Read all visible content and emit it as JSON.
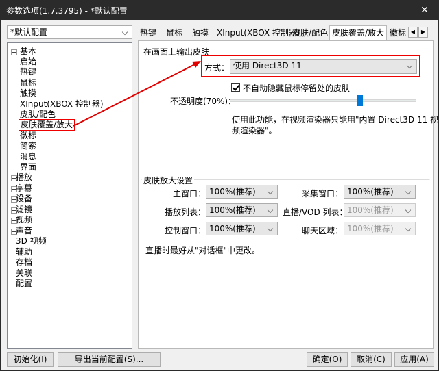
{
  "window": {
    "title": "参数选项(1.7.3795) - *默认配置",
    "close_glyph": "✕"
  },
  "profile": {
    "selected": "*默认配置"
  },
  "tree": {
    "root_basic": "基本",
    "basic_children": [
      "启始",
      "热键",
      "鼠标",
      "触摸",
      "XInput(XBOX 控制器)",
      "皮肤/配色",
      "皮肤覆盖/放大",
      "徽标",
      "简索",
      "消息",
      "界面"
    ],
    "others": [
      {
        "label": "播放",
        "expandable": true
      },
      {
        "label": "字幕",
        "expandable": true
      },
      {
        "label": "设备",
        "expandable": true
      },
      {
        "label": "滤镜",
        "expandable": true
      },
      {
        "label": "视频",
        "expandable": true
      },
      {
        "label": "声音",
        "expandable": true
      },
      {
        "label": "3D 视频",
        "expandable": false
      },
      {
        "label": "辅助",
        "expandable": false
      },
      {
        "label": "存档",
        "expandable": false
      },
      {
        "label": "关联",
        "expandable": false
      },
      {
        "label": "配置",
        "expandable": false
      }
    ]
  },
  "tabs": [
    "热键",
    "鼠标",
    "触摸",
    "XInput(XBOX 控制器)",
    "皮肤/配色",
    "皮肤覆盖/放大",
    "徽标"
  ],
  "tab_nav": {
    "prev": "◀",
    "next": "▶"
  },
  "output_group": {
    "title": "在画面上输出皮肤",
    "mode_label": "方式：",
    "mode_value": "使用 Direct3D 11",
    "checkbox_label": "不自动隐藏鼠标停留处的皮肤",
    "checkbox_checked": true,
    "opacity_label": "不透明度(70%)：",
    "opacity_value": 0.7,
    "note_line1": "使用此功能，在视频渲染器只能用\"内置 Direct3D 11 视",
    "note_line2": "频渲染器\"。"
  },
  "zoom_group": {
    "title": "皮肤放大设置",
    "rows": [
      {
        "left_label": "主窗口：",
        "left_value": "100%(推荐)",
        "right_label": "采集窗口：",
        "right_value": "100%(推荐)",
        "right_disabled": false
      },
      {
        "left_label": "播放列表：",
        "left_value": "100%(推荐)",
        "right_label": "直播/VOD 列表：",
        "right_value": "100%(推荐)",
        "right_disabled": true
      },
      {
        "left_label": "控制窗口：",
        "left_value": "100%(推荐)",
        "right_label": "聊天区域：",
        "right_value": "100%(推荐)",
        "right_disabled": true
      }
    ],
    "note": "直播时最好从\"对话框\"中更改。"
  },
  "buttons": {
    "init": "初始化(I)",
    "export": "导出当前配置(S)...",
    "ok": "确定(O)",
    "cancel": "取消(C)",
    "apply": "应用(A)"
  },
  "colors": {
    "annotation_red": "#e00000",
    "accent_blue": "#0078d7"
  }
}
